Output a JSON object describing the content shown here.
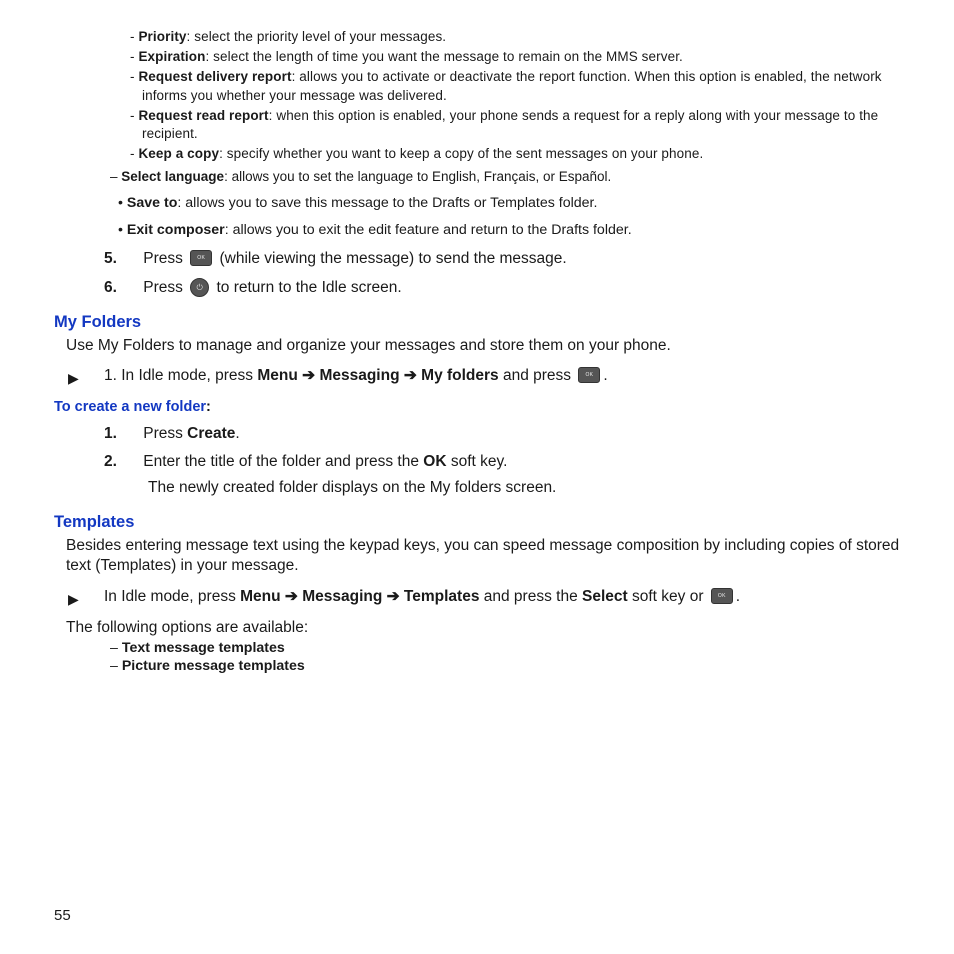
{
  "sendingOptions": {
    "priority": {
      "term": "Priority",
      "desc": ": select the priority level of your messages."
    },
    "expiration": {
      "term": "Expiration",
      "desc": ": select the length of time you want the message to remain on the MMS server."
    },
    "deliveryReport": {
      "term": "Request delivery report",
      "desc": ": allows you to activate or deactivate the report function. When this option is enabled, the network informs you whether your message was delivered."
    },
    "readReport": {
      "term": "Request read report",
      "desc": ": when this option is enabled, your phone sends a request for a reply along with your message to the recipient."
    },
    "keepCopy": {
      "term": "Keep a copy",
      "desc": ": specify whether you want to keep a copy of the sent messages on your phone."
    },
    "selectLanguage": {
      "term": "Select language",
      "desc": ": allows you to set the language to English, Français, or Español."
    },
    "saveTo": {
      "term": "Save to",
      "desc": ": allows you to save this message to the Drafts or Templates folder."
    },
    "exitComposer": {
      "term": "Exit composer",
      "desc": ": allows you to exit the edit feature and return to the Drafts folder."
    }
  },
  "step5": {
    "num": "5.",
    "a": "Press ",
    "b": " (while viewing the message) to send the message."
  },
  "step6": {
    "num": "6.",
    "a": "Press ",
    "b": " to return to the Idle screen."
  },
  "myFolders": {
    "heading": "My Folders",
    "body": "Use My Folders to manage and organize your messages and store them on your phone.",
    "stepPrefix": "1. In Idle mode, press ",
    "menu": "Menu",
    "arrow": " ➔ ",
    "messaging": "Messaging",
    "myfolders": "My folders",
    "andPress": " and press ",
    "period": ".",
    "subhead": "To create a new folder",
    "colon": ":",
    "s1num": "1.",
    "s1a": "Press ",
    "s1b": "Create",
    "s1c": ".",
    "s2num": "2.",
    "s2a": "Enter the title of the folder and press the ",
    "s2b": "OK",
    "s2c": " soft key.",
    "s2cont": "The newly created folder displays on the My folders screen."
  },
  "templates": {
    "heading": "Templates",
    "body": "Besides entering message text using the keypad keys, you can speed message composition by including copies of stored text (Templates) in your message.",
    "stepPrefix": "In Idle mode, press ",
    "menu": "Menu",
    "arrow": " ➔ ",
    "messaging": "Messaging",
    "templates": "Templates",
    "andPress": " and press the ",
    "select": "Select",
    "softkeyOr": " soft key or ",
    "period": ".",
    "optionsIntro": "The following options are available:",
    "opt1": "Text message templates",
    "opt2": "Picture message templates"
  },
  "pageNumber": "55"
}
